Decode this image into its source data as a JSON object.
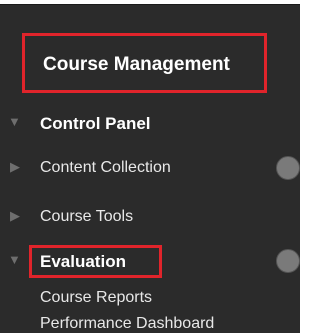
{
  "header": {
    "title": "Course Management"
  },
  "menu": {
    "items": [
      {
        "label": "Control Panel",
        "expanded": true,
        "icon": "chevron-down-icon"
      },
      {
        "label": "Content Collection",
        "expanded": false,
        "icon": "chevron-right-icon"
      },
      {
        "label": "Course Tools",
        "expanded": false,
        "icon": "chevron-right-icon"
      },
      {
        "label": "Evaluation",
        "expanded": true,
        "icon": "chevron-down-icon"
      }
    ],
    "evaluation_subitems": [
      {
        "label": "Course Reports"
      },
      {
        "label": "Performance Dashboard"
      }
    ]
  },
  "colors": {
    "panel_background": "#2b2b2b",
    "highlight_border": "#e0242b",
    "text": "#ffffff"
  }
}
